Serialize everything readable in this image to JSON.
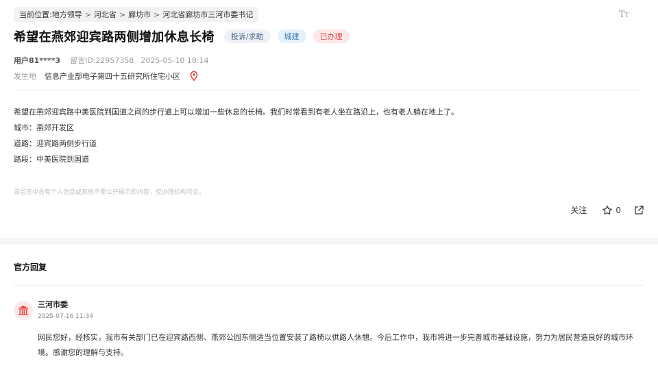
{
  "breadcrumb": {
    "prefix": "当前位置:",
    "items": [
      "地方领导",
      "河北省",
      "廊坊市",
      "河北省廊坊市三河市委书记"
    ],
    "separator": ">"
  },
  "font_size_icon": "font-size-toggle-icon",
  "message": {
    "title": "希望在燕郊迎宾路两侧增加休息长椅",
    "tags": {
      "type": "投诉/求助",
      "category": "城建",
      "status": "已办理"
    },
    "user": "用户81****3",
    "message_id": "留言ID:22957358",
    "datetime": "2025-05-10 18:14",
    "place_label": "发生地",
    "place_value": "信息产业部电子第四十五研究所住宅小区",
    "content_lines": [
      "希望在燕郊迎宾路中美医院到国道之间的步行道上可以增加一些休息的长椅。我们时常看到有老人坐在路沿上，也有老人躺在地上了。",
      "城市：燕郊开发区",
      "道路：迎宾路两侧步行道",
      "路段：中美医院到国道"
    ],
    "privacy_note": "该留言中含有个人信息或其他不便公开展示的内容，仅办理机构可见。"
  },
  "actions": {
    "follow": "关注",
    "star_count": "0"
  },
  "reply": {
    "heading": "官方回复",
    "org_name": "三河市委",
    "org_time": "2025-07-16 11:34",
    "text": "网民您好，经核实，我市有关部门已在迎宾路西侧、燕郊公园东侧适当位置安装了路椅以供路人休憩。今后工作中，我市将进一步完善城市基础设施，努力为居民营造良好的城市环境。感谢您的理解与支持。"
  },
  "colors": {
    "status_red": "#e04a4a",
    "category_blue": "#3a7cb8",
    "pin_red": "#e84545"
  }
}
